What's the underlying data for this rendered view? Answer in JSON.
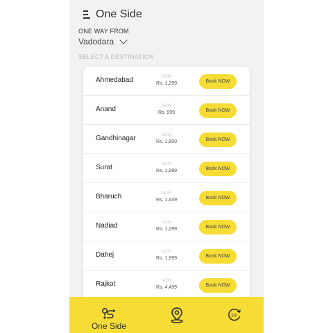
{
  "app": {
    "title": "One Side"
  },
  "trip": {
    "from_label": "ONE WAY FROM",
    "from_city": "Vadodara",
    "destination_label": "SELECT A DESTINATION"
  },
  "destinations": [
    {
      "city": "Ahmedabad",
      "now": "NOW",
      "price": "Rs. 1,299",
      "button": "Book NOW"
    },
    {
      "city": "Anand",
      "now": "NOW",
      "price": "Rs. 999",
      "button": "Book NOW"
    },
    {
      "city": "Gandhinagar",
      "now": "NOW",
      "price": "Rs. 1,800",
      "button": "Book NOW"
    },
    {
      "city": "Surat",
      "now": "NOW",
      "price": "Rs. 1,999",
      "button": "Book NOW"
    },
    {
      "city": "Bharuch",
      "now": "NOW",
      "price": "Rs. 1,449",
      "button": "Book NOW"
    },
    {
      "city": "Nadiad",
      "now": "NOW",
      "price": "Rs. 1,299",
      "button": "Book NOW"
    },
    {
      "city": "Dahej",
      "now": "NOW",
      "price": "Rs. 1,999",
      "button": "Book NOW"
    },
    {
      "city": "Rajkot",
      "now": "NOW",
      "price": "Rs. 4,499",
      "button": "Book NOW"
    }
  ],
  "bottom_nav": {
    "items": [
      {
        "label": "One Side",
        "icon": "route-icon",
        "active": true
      },
      {
        "label": "",
        "icon": "location-pin-icon",
        "active": false
      },
      {
        "label": "",
        "icon": "history-icon",
        "active": false
      }
    ]
  },
  "colors": {
    "accent": "#f6dc34",
    "background": "#f2f2f2",
    "card": "#ffffff",
    "text": "#333333"
  }
}
